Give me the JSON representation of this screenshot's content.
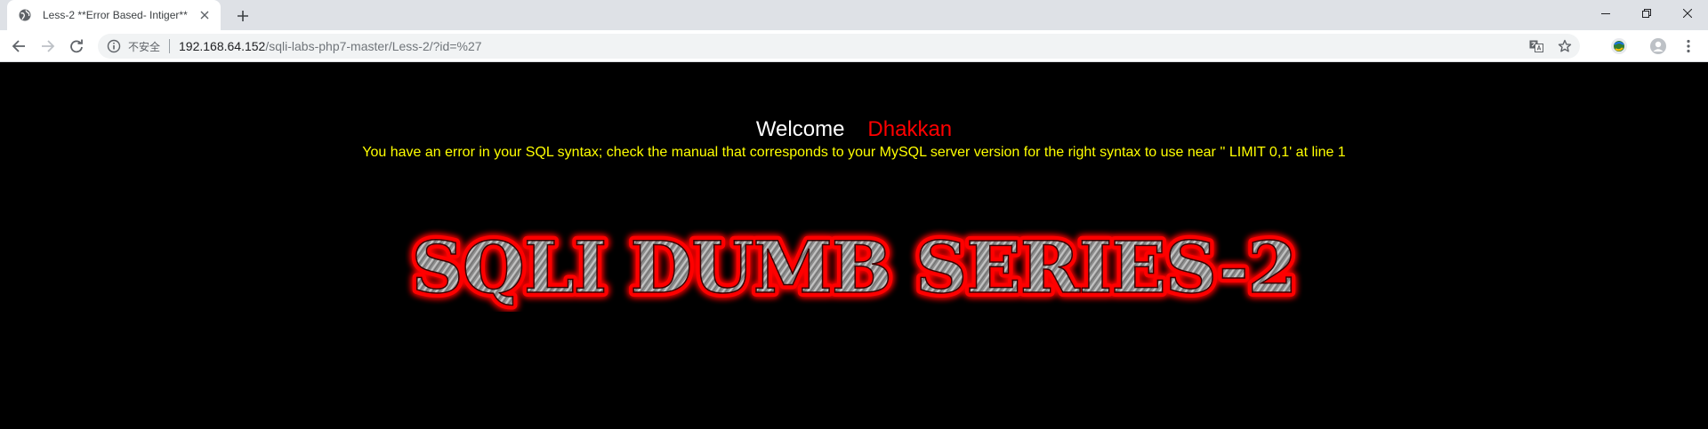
{
  "browser": {
    "tab": {
      "title": "Less-2 **Error Based- Intiger**"
    },
    "address_bar": {
      "security_label": "不安全",
      "url_host": "192.168.64.152",
      "url_path": "/sqli-labs-php7-master/Less-2/?id=%27"
    },
    "icons": [
      "globe-icon",
      "close-icon",
      "plus-icon",
      "back-icon",
      "forward-icon",
      "reload-icon",
      "info-icon",
      "translate-icon",
      "star-icon",
      "extension-icon",
      "profile-icon",
      "menu-icon",
      "minimize-icon",
      "restore-icon"
    ]
  },
  "page": {
    "welcome": "Welcome",
    "username": "Dhakkan",
    "error_message": "You have an error in your SQL syntax; check the manual that corresponds to your MySQL server version for the right syntax to use near '' LIMIT 0,1' at line 1",
    "banner_text": "SQLI DUMB SERIES-2"
  },
  "colors": {
    "page_background": "#000000",
    "welcome": "#ffffff",
    "username": "#ff0000",
    "error": "#ffff00",
    "banner_glow": "#ff0000",
    "banner_fill": "#9a9a9a"
  }
}
